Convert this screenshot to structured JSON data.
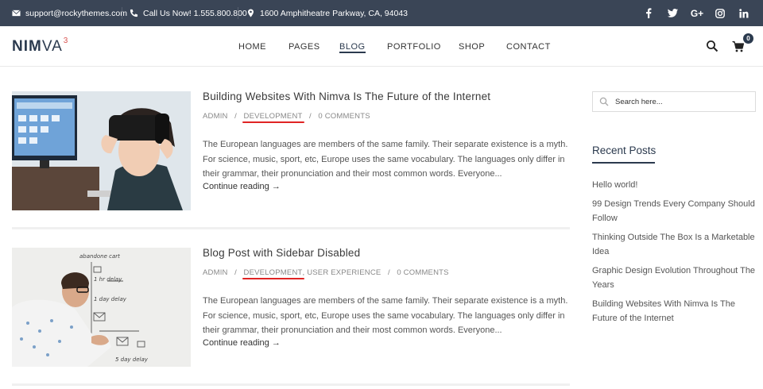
{
  "topbar": {
    "email": "support@rockythemes.com",
    "phone": "Call Us Now! 1.555.800.800",
    "address": "1600 Amphitheatre Parkway, CA, 94043",
    "social": [
      "f",
      "t",
      "G+",
      "ig",
      "in"
    ]
  },
  "logo": {
    "bold": "NIM",
    "light": "VA",
    "sup": "3"
  },
  "nav": [
    "HOME",
    "PAGES",
    "BLOG",
    "PORTFOLIO",
    "SHOP",
    "CONTACT"
  ],
  "cart": {
    "count": "0"
  },
  "posts": [
    {
      "title": "Building Websites With Nimva Is The Future of the Internet",
      "author": "ADMIN",
      "categories": "DEVELOPMENT",
      "extra_category": "",
      "comments": "0 COMMENTS",
      "excerpt": "The European languages are members of the same family. Their separate existence is a myth. For science, music, sport, etc, Europe uses the same vocabulary. The languages only differ in their grammar, their pronunciation and their most common words. Everyone...",
      "more": "Continue reading →"
    },
    {
      "title": "Blog Post with Sidebar Disabled",
      "author": "ADMIN",
      "categories": "DEVELOPMENT",
      "extra_category": ", USER EXPERIENCE",
      "comments": "0 COMMENTS",
      "excerpt": "The European languages are members of the same family. Their separate existence is a myth. For science, music, sport, etc, Europe uses the same vocabulary. The languages only differ in their grammar, their pronunciation and their most common words. Everyone...",
      "more": "Continue reading →"
    }
  ],
  "sidebar": {
    "search_placeholder": "Search here...",
    "recent_title": "Recent Posts",
    "recent": [
      "Hello world!",
      "99 Design Trends Every Company Should Follow",
      "Thinking Outside The Box Is a Marketable Idea",
      "Graphic Design Evolution Throughout The Years",
      "Building Websites With Nimva Is The Future of the Internet"
    ]
  },
  "image_text": {
    "whiteboard": [
      "abandone cart",
      "1 hr delay",
      "1 day delay",
      "5 day delay"
    ]
  },
  "colors": {
    "topbar": "#3a4556",
    "brand": "#2b3a4e",
    "accent": "#d9534f",
    "underline": "#e02424"
  }
}
